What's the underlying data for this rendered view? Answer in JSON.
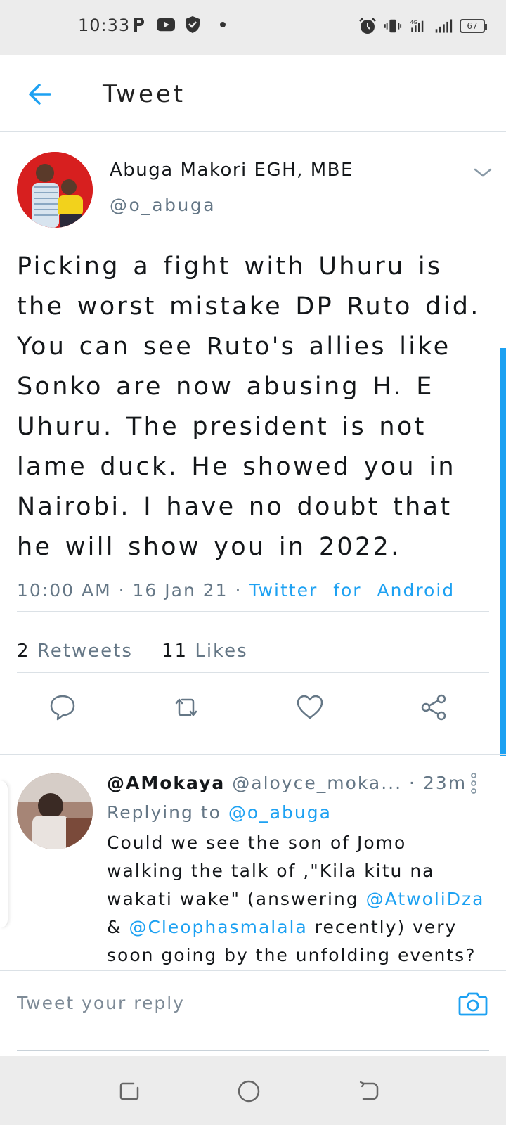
{
  "status_bar": {
    "time": "10:33",
    "battery": "67",
    "network": "4G",
    "left_icons": [
      "p-icon",
      "youtube-icon",
      "shield-icon",
      "dot-icon"
    ],
    "right_icons": [
      "alarm-icon",
      "vibrate-icon",
      "signal-icon",
      "signal-icon",
      "battery-icon"
    ]
  },
  "header": {
    "title": "Tweet",
    "back_icon": "arrow-left-icon"
  },
  "tweet": {
    "author_name": "Abuga Makori EGH, MBE",
    "author_handle": "@o_abuga",
    "text": "Picking a fight with Uhuru is the worst mistake DP Ruto did. You can see Ruto's allies like Sonko are now abusing H. E Uhuru. The president is not lame duck. He showed you in Nairobi. I have no doubt that he will show you in 2022.",
    "time": "10:00 AM",
    "date": "16 Jan 21",
    "separator": "·",
    "source": "Twitter for Android",
    "retweets_count": "2",
    "retweets_label": "Retweets",
    "likes_count": "11",
    "likes_label": "Likes",
    "actions": [
      "comment-icon",
      "retweet-icon",
      "like-icon",
      "share-icon"
    ]
  },
  "reply": {
    "name": "@AMokaya",
    "handle": "@aloyce_moka...",
    "time": "· 23m",
    "replying_to_label": "Replying to",
    "replying_to_handle": "@o_abuga",
    "text_1": "Could we see the son of Jomo walking the talk of ,\"Kila kitu na wakati wake\" (answering ",
    "mention_1": "@AtwoliDza",
    "text_2": " & ",
    "mention_2": "@Cleophasmalala",
    "text_3": " recently) very soon going by the unfolding events?"
  },
  "compose": {
    "placeholder": "Tweet your reply",
    "camera_icon": "camera-icon"
  },
  "nav_bar": {
    "buttons": [
      "recents-icon",
      "home-icon",
      "back-icon"
    ]
  },
  "colors": {
    "accent": "#1da1f2",
    "secondary_text": "#657786",
    "primary_text": "#14171a",
    "divider": "#dbe1e6"
  }
}
